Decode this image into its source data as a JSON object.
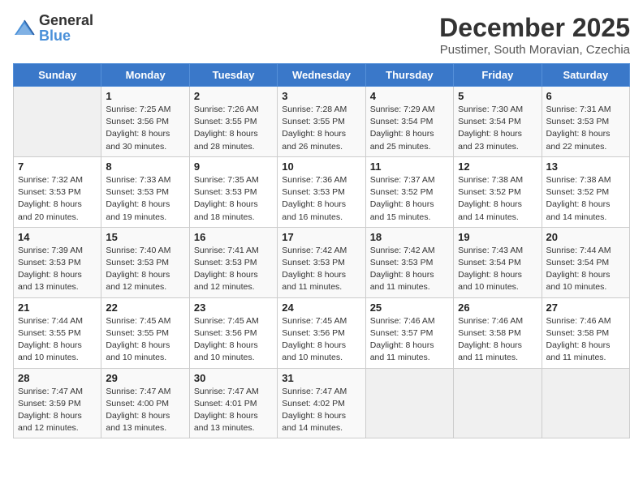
{
  "header": {
    "logo_general": "General",
    "logo_blue": "Blue",
    "month_year": "December 2025",
    "location": "Pustimer, South Moravian, Czechia"
  },
  "days_of_week": [
    "Sunday",
    "Monday",
    "Tuesday",
    "Wednesday",
    "Thursday",
    "Friday",
    "Saturday"
  ],
  "weeks": [
    [
      {
        "day": "",
        "info": ""
      },
      {
        "day": "1",
        "info": "Sunrise: 7:25 AM\nSunset: 3:56 PM\nDaylight: 8 hours\nand 30 minutes."
      },
      {
        "day": "2",
        "info": "Sunrise: 7:26 AM\nSunset: 3:55 PM\nDaylight: 8 hours\nand 28 minutes."
      },
      {
        "day": "3",
        "info": "Sunrise: 7:28 AM\nSunset: 3:55 PM\nDaylight: 8 hours\nand 26 minutes."
      },
      {
        "day": "4",
        "info": "Sunrise: 7:29 AM\nSunset: 3:54 PM\nDaylight: 8 hours\nand 25 minutes."
      },
      {
        "day": "5",
        "info": "Sunrise: 7:30 AM\nSunset: 3:54 PM\nDaylight: 8 hours\nand 23 minutes."
      },
      {
        "day": "6",
        "info": "Sunrise: 7:31 AM\nSunset: 3:53 PM\nDaylight: 8 hours\nand 22 minutes."
      }
    ],
    [
      {
        "day": "7",
        "info": "Sunrise: 7:32 AM\nSunset: 3:53 PM\nDaylight: 8 hours\nand 20 minutes."
      },
      {
        "day": "8",
        "info": "Sunrise: 7:33 AM\nSunset: 3:53 PM\nDaylight: 8 hours\nand 19 minutes."
      },
      {
        "day": "9",
        "info": "Sunrise: 7:35 AM\nSunset: 3:53 PM\nDaylight: 8 hours\nand 18 minutes."
      },
      {
        "day": "10",
        "info": "Sunrise: 7:36 AM\nSunset: 3:53 PM\nDaylight: 8 hours\nand 16 minutes."
      },
      {
        "day": "11",
        "info": "Sunrise: 7:37 AM\nSunset: 3:52 PM\nDaylight: 8 hours\nand 15 minutes."
      },
      {
        "day": "12",
        "info": "Sunrise: 7:38 AM\nSunset: 3:52 PM\nDaylight: 8 hours\nand 14 minutes."
      },
      {
        "day": "13",
        "info": "Sunrise: 7:38 AM\nSunset: 3:52 PM\nDaylight: 8 hours\nand 14 minutes."
      }
    ],
    [
      {
        "day": "14",
        "info": "Sunrise: 7:39 AM\nSunset: 3:53 PM\nDaylight: 8 hours\nand 13 minutes."
      },
      {
        "day": "15",
        "info": "Sunrise: 7:40 AM\nSunset: 3:53 PM\nDaylight: 8 hours\nand 12 minutes."
      },
      {
        "day": "16",
        "info": "Sunrise: 7:41 AM\nSunset: 3:53 PM\nDaylight: 8 hours\nand 12 minutes."
      },
      {
        "day": "17",
        "info": "Sunrise: 7:42 AM\nSunset: 3:53 PM\nDaylight: 8 hours\nand 11 minutes."
      },
      {
        "day": "18",
        "info": "Sunrise: 7:42 AM\nSunset: 3:53 PM\nDaylight: 8 hours\nand 11 minutes."
      },
      {
        "day": "19",
        "info": "Sunrise: 7:43 AM\nSunset: 3:54 PM\nDaylight: 8 hours\nand 10 minutes."
      },
      {
        "day": "20",
        "info": "Sunrise: 7:44 AM\nSunset: 3:54 PM\nDaylight: 8 hours\nand 10 minutes."
      }
    ],
    [
      {
        "day": "21",
        "info": "Sunrise: 7:44 AM\nSunset: 3:55 PM\nDaylight: 8 hours\nand 10 minutes."
      },
      {
        "day": "22",
        "info": "Sunrise: 7:45 AM\nSunset: 3:55 PM\nDaylight: 8 hours\nand 10 minutes."
      },
      {
        "day": "23",
        "info": "Sunrise: 7:45 AM\nSunset: 3:56 PM\nDaylight: 8 hours\nand 10 minutes."
      },
      {
        "day": "24",
        "info": "Sunrise: 7:45 AM\nSunset: 3:56 PM\nDaylight: 8 hours\nand 10 minutes."
      },
      {
        "day": "25",
        "info": "Sunrise: 7:46 AM\nSunset: 3:57 PM\nDaylight: 8 hours\nand 11 minutes."
      },
      {
        "day": "26",
        "info": "Sunrise: 7:46 AM\nSunset: 3:58 PM\nDaylight: 8 hours\nand 11 minutes."
      },
      {
        "day": "27",
        "info": "Sunrise: 7:46 AM\nSunset: 3:58 PM\nDaylight: 8 hours\nand 11 minutes."
      }
    ],
    [
      {
        "day": "28",
        "info": "Sunrise: 7:47 AM\nSunset: 3:59 PM\nDaylight: 8 hours\nand 12 minutes."
      },
      {
        "day": "29",
        "info": "Sunrise: 7:47 AM\nSunset: 4:00 PM\nDaylight: 8 hours\nand 13 minutes."
      },
      {
        "day": "30",
        "info": "Sunrise: 7:47 AM\nSunset: 4:01 PM\nDaylight: 8 hours\nand 13 minutes."
      },
      {
        "day": "31",
        "info": "Sunrise: 7:47 AM\nSunset: 4:02 PM\nDaylight: 8 hours\nand 14 minutes."
      },
      {
        "day": "",
        "info": ""
      },
      {
        "day": "",
        "info": ""
      },
      {
        "day": "",
        "info": ""
      }
    ]
  ]
}
